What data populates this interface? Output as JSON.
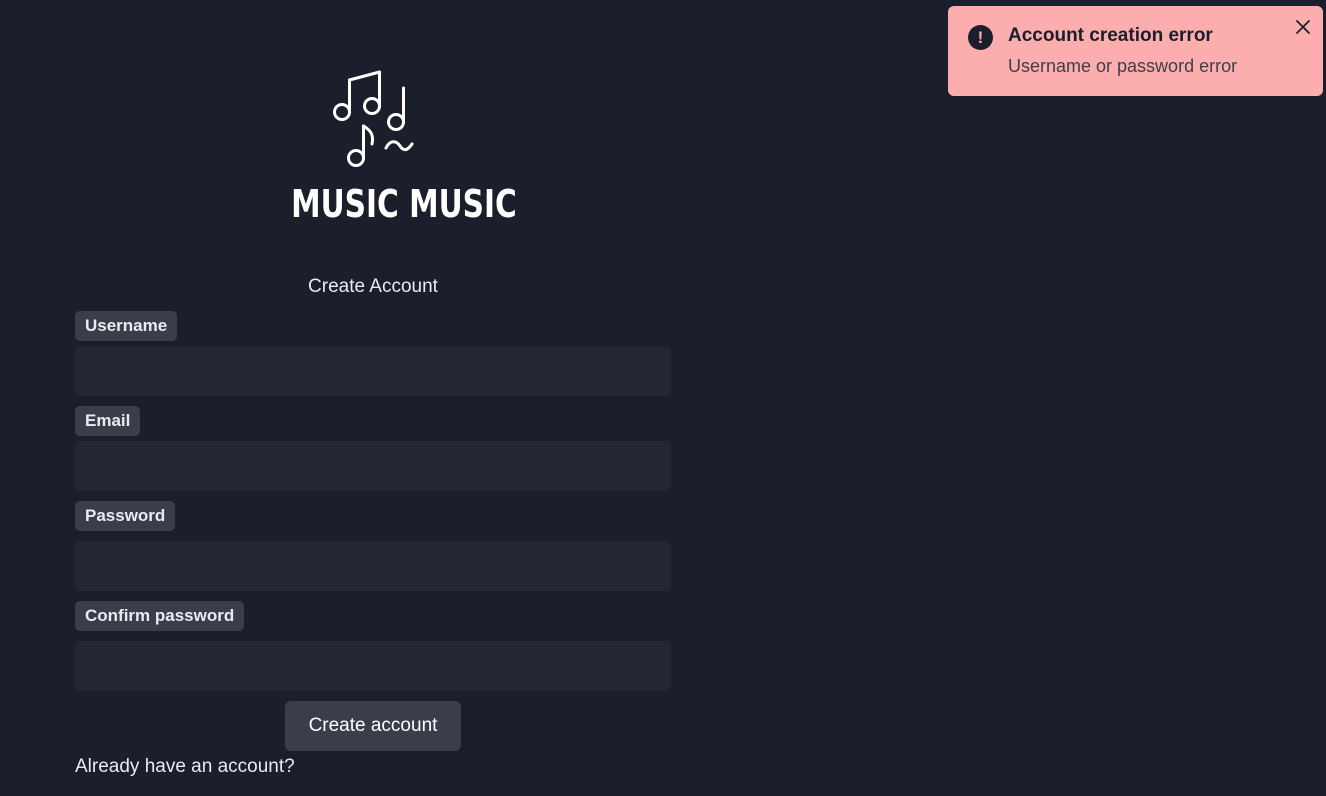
{
  "app": {
    "logo_text": "MUSIC MUSIC",
    "logo_icon": "music-notes-icon"
  },
  "form": {
    "title": "Create Account",
    "fields": [
      {
        "label": "Username",
        "value": "",
        "placeholder": ""
      },
      {
        "label": "Email",
        "value": "",
        "placeholder": ""
      },
      {
        "label": "Password",
        "value": "",
        "placeholder": ""
      },
      {
        "label": "Confirm password",
        "value": "",
        "placeholder": ""
      }
    ],
    "submit_label": "Create account",
    "signin_link": "Already have an account?"
  },
  "toast": {
    "title": "Account creation error",
    "message": "Username or password error",
    "icon": "exclamation-icon",
    "icon_glyph": "!",
    "close_icon": "close-icon",
    "background_color": "#fcaeae"
  },
  "colors": {
    "page_background": "#1b1f2b",
    "input_background": "#232733",
    "label_background": "#3a3e4b",
    "button_background": "#3a3e4b"
  }
}
